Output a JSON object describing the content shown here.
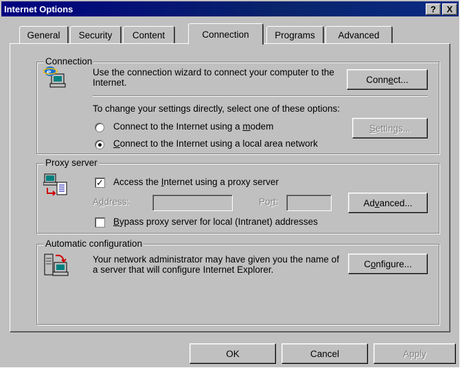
{
  "window": {
    "title": "Internet Options",
    "help_btn": "?",
    "close_btn": "X"
  },
  "tabs": [
    {
      "label": "General"
    },
    {
      "label": "Security"
    },
    {
      "label": "Content"
    },
    {
      "label": "Connection",
      "active": true
    },
    {
      "label": "Programs"
    },
    {
      "label": "Advanced"
    }
  ],
  "connection": {
    "legend": "Connection",
    "wizard_text": "Use the connection wizard to connect your computer to the Internet.",
    "connect_button": {
      "pre": "Conn",
      "key": "e",
      "post": "ct..."
    },
    "change_text": "To change your settings directly, select one of these options:",
    "modem_option": {
      "pre": "Connect to the Internet using a ",
      "key": "m",
      "post": "odem",
      "selected": false
    },
    "settings_button": {
      "key": "S",
      "post": "ettings...",
      "disabled": true
    },
    "lan_option": {
      "key": "C",
      "post": "onnect to the Internet using a local area network",
      "selected": true
    }
  },
  "proxy": {
    "legend": "Proxy server",
    "use_proxy": {
      "pre": "Access the ",
      "key": "I",
      "post": "nternet using a proxy server",
      "checked": true
    },
    "address_label": {
      "pre": "A",
      "key": "d",
      "post": "dress:"
    },
    "address_value": "",
    "port_label": {
      "pre": "Po",
      "key": "r",
      "post": "t:"
    },
    "port_value": "",
    "advanced_button": {
      "pre": "Ad",
      "key": "v",
      "post": "anced..."
    },
    "bypass": {
      "key": "B",
      "post": "ypass proxy server for local (Intranet) addresses",
      "checked": false
    }
  },
  "autoconfig": {
    "legend": "Automatic configuration",
    "text": "Your network administrator may have given you the name of a server that will configure Internet Explorer.",
    "configure_button": {
      "pre": "C",
      "key": "o",
      "post": "nfigure..."
    }
  },
  "footer": {
    "ok": "OK",
    "cancel": "Cancel",
    "apply": "Apply"
  }
}
